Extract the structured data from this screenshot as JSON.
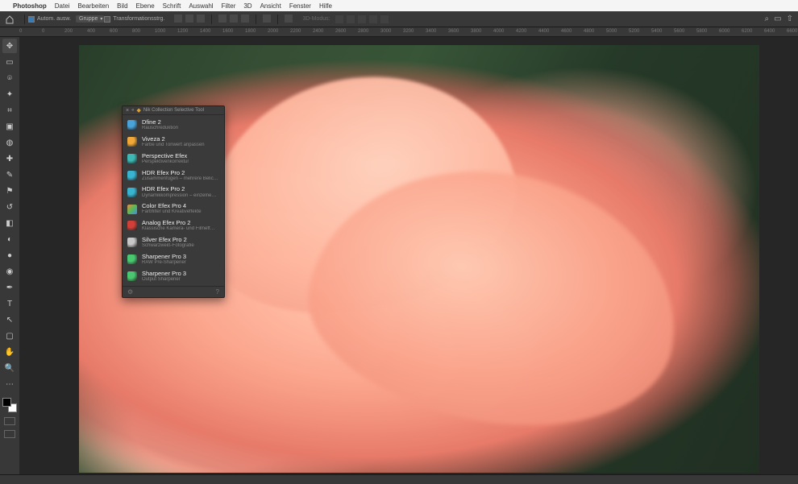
{
  "menubar": {
    "app": "Photoshop",
    "items": [
      "Datei",
      "Bearbeiten",
      "Bild",
      "Ebene",
      "Schrift",
      "Auswahl",
      "Filter",
      "3D",
      "Ansicht",
      "Fenster",
      "Hilfe"
    ]
  },
  "optbar": {
    "auto_label": "Autom. ausw.",
    "dd_value": "Gruppe",
    "transform_label": "Transformationsstrg.",
    "mode_label": "3D-Modus:"
  },
  "ruler": {
    "ticks": [
      "0",
      "0",
      "200",
      "400",
      "600",
      "800",
      "1000",
      "1200",
      "1400",
      "1600",
      "1800",
      "2000",
      "2200",
      "2400",
      "2600",
      "2800",
      "3000",
      "3200",
      "3400",
      "3600",
      "3800",
      "4000",
      "4200",
      "4400",
      "4600",
      "4800",
      "5000",
      "5200",
      "5400",
      "5600",
      "5800",
      "6000",
      "6200",
      "6400",
      "6600"
    ]
  },
  "tools": [
    {
      "name": "move-tool",
      "glyph": "✥",
      "active": true
    },
    {
      "name": "marquee-tool",
      "glyph": "▭"
    },
    {
      "name": "lasso-tool",
      "glyph": "⌾"
    },
    {
      "name": "wand-tool",
      "glyph": "✦"
    },
    {
      "name": "crop-tool",
      "glyph": "⌗"
    },
    {
      "name": "frame-tool",
      "glyph": "▣"
    },
    {
      "name": "eyedropper-tool",
      "glyph": "◍"
    },
    {
      "name": "heal-tool",
      "glyph": "✚"
    },
    {
      "name": "brush-tool",
      "glyph": "✎"
    },
    {
      "name": "stamp-tool",
      "glyph": "⚑"
    },
    {
      "name": "history-brush-tool",
      "glyph": "↺"
    },
    {
      "name": "eraser-tool",
      "glyph": "◧"
    },
    {
      "name": "gradient-tool",
      "glyph": "◐"
    },
    {
      "name": "blur-tool",
      "glyph": "●"
    },
    {
      "name": "dodge-tool",
      "glyph": "◉"
    },
    {
      "name": "pen-tool",
      "glyph": "✒"
    },
    {
      "name": "type-tool",
      "glyph": "T"
    },
    {
      "name": "path-tool",
      "glyph": "↖"
    },
    {
      "name": "shape-tool",
      "glyph": "▢"
    },
    {
      "name": "hand-tool",
      "glyph": "✋"
    },
    {
      "name": "zoom-tool",
      "glyph": "🔍"
    },
    {
      "name": "more-tool",
      "glyph": "⋯"
    }
  ],
  "swatch": {
    "fg": "#000000",
    "bg": "#ffffff"
  },
  "nik": {
    "title": "Nik Collection Selective Tool",
    "plugins": [
      {
        "title": "Dfine 2",
        "sub": "Rauschreduktion",
        "color": "#4aa3d8"
      },
      {
        "title": "Viveza 2",
        "sub": "Farbe und Tonwert anpassen",
        "color": "#f0a838"
      },
      {
        "title": "Perspective Efex",
        "sub": "Perspektivenkorrektur",
        "color": "#3db8b4"
      },
      {
        "title": "HDR Efex Pro 2",
        "sub": "Zusammenfügen – mehrere Belic…",
        "color": "#38b4d0"
      },
      {
        "title": "HDR Efex Pro 2",
        "sub": "Dynamikkompression – einzelne…",
        "color": "#38b4d0"
      },
      {
        "title": "Color Efex Pro 4",
        "sub": "Farbfilter und Kreativeffekte",
        "color": "linear-gradient(135deg,#e84,#5b5,#48e)"
      },
      {
        "title": "Analog Efex Pro 2",
        "sub": "Klassische Kamera- und Filmeff…",
        "color": "#d04038"
      },
      {
        "title": "Silver Efex Pro 2",
        "sub": "Schwarzweiß-Fotografie",
        "color": "#c8c8c8"
      },
      {
        "title": "Sharpener Pro 3",
        "sub": "RAW Pre-Sharpener",
        "color": "#4ac870"
      },
      {
        "title": "Sharpener Pro 3",
        "sub": "Output Sharpener",
        "color": "#4ac870"
      }
    ]
  },
  "status": {
    "text": ""
  }
}
